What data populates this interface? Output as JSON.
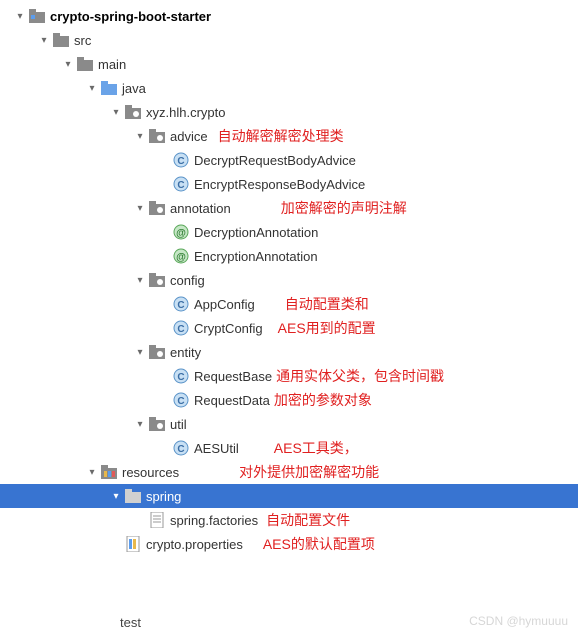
{
  "root": {
    "name": "crypto-spring-boot-starter",
    "children": {
      "src": {
        "name": "src",
        "main": {
          "name": "main",
          "java": {
            "name": "java",
            "pkg": {
              "name": "xyz.hlh.crypto",
              "advice": {
                "name": "advice",
                "note": "自动解密解密处理类",
                "c1": "DecryptRequestBodyAdvice",
                "c2": "EncryptResponseBodyAdvice"
              },
              "annotation": {
                "name": "annotation",
                "note": "加密解密的声明注解",
                "c1": "DecryptionAnnotation",
                "c2": "EncryptionAnnotation"
              },
              "config": {
                "name": "config",
                "c1": "AppConfig",
                "c1note": "自动配置类和",
                "c2": "CryptConfig",
                "c2note": "AES用到的配置"
              },
              "entity": {
                "name": "entity",
                "c1": "RequestBase",
                "c1note": "通用实体父类，包含时间戳",
                "c2": "RequestData",
                "c2note": "加密的参数对象"
              },
              "util": {
                "name": "util",
                "c1": "AESUtil",
                "c1note": "AES工具类，"
              }
            }
          },
          "resources": {
            "name": "resources",
            "note": "对外提供加密解密功能",
            "spring": {
              "name": "spring",
              "f1": "spring.factories",
              "f1note": "自动配置文件"
            },
            "f2": "crypto.properties",
            "f2note": "AES的默认配置项"
          }
        }
      }
    }
  },
  "truncated": "test",
  "watermark": "CSDN @hymuuuu"
}
